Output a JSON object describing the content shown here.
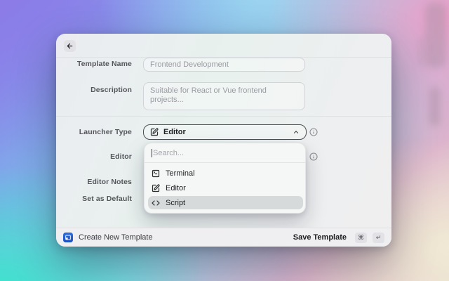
{
  "window": {
    "back_icon": "arrow-left"
  },
  "form": {
    "template_name": {
      "label": "Template Name",
      "value": "Frontend Development"
    },
    "description": {
      "label": "Description",
      "value": "Suitable for React or Vue frontend projects..."
    },
    "launcher_type": {
      "label": "Launcher Type",
      "value": "Editor"
    },
    "editor": {
      "label": "Editor"
    },
    "editor_notes": {
      "label": "Editor Notes"
    },
    "set_as_default": {
      "label": "Set as Default"
    }
  },
  "dropdown": {
    "search_placeholder": "Search...",
    "options": [
      {
        "label": "Terminal",
        "icon": "terminal-icon",
        "highlighted": false
      },
      {
        "label": "Editor",
        "icon": "editor-pen-icon",
        "highlighted": false
      },
      {
        "label": "Script",
        "icon": "code-icon",
        "highlighted": true
      }
    ]
  },
  "footer": {
    "title": "Create New Template",
    "save_label": "Save Template",
    "shortcut_keys": [
      "⌘",
      "↵"
    ]
  },
  "colors": {
    "select_border": "#4b4d52",
    "option_highlight": "#d6dada",
    "app_icon_blue": "#1c4fc2",
    "bg_purple": "#8b7ce8",
    "bg_teal": "#3ee2cd",
    "bg_pink": "#ee9cc6",
    "bg_cream": "#f0e9d4"
  }
}
